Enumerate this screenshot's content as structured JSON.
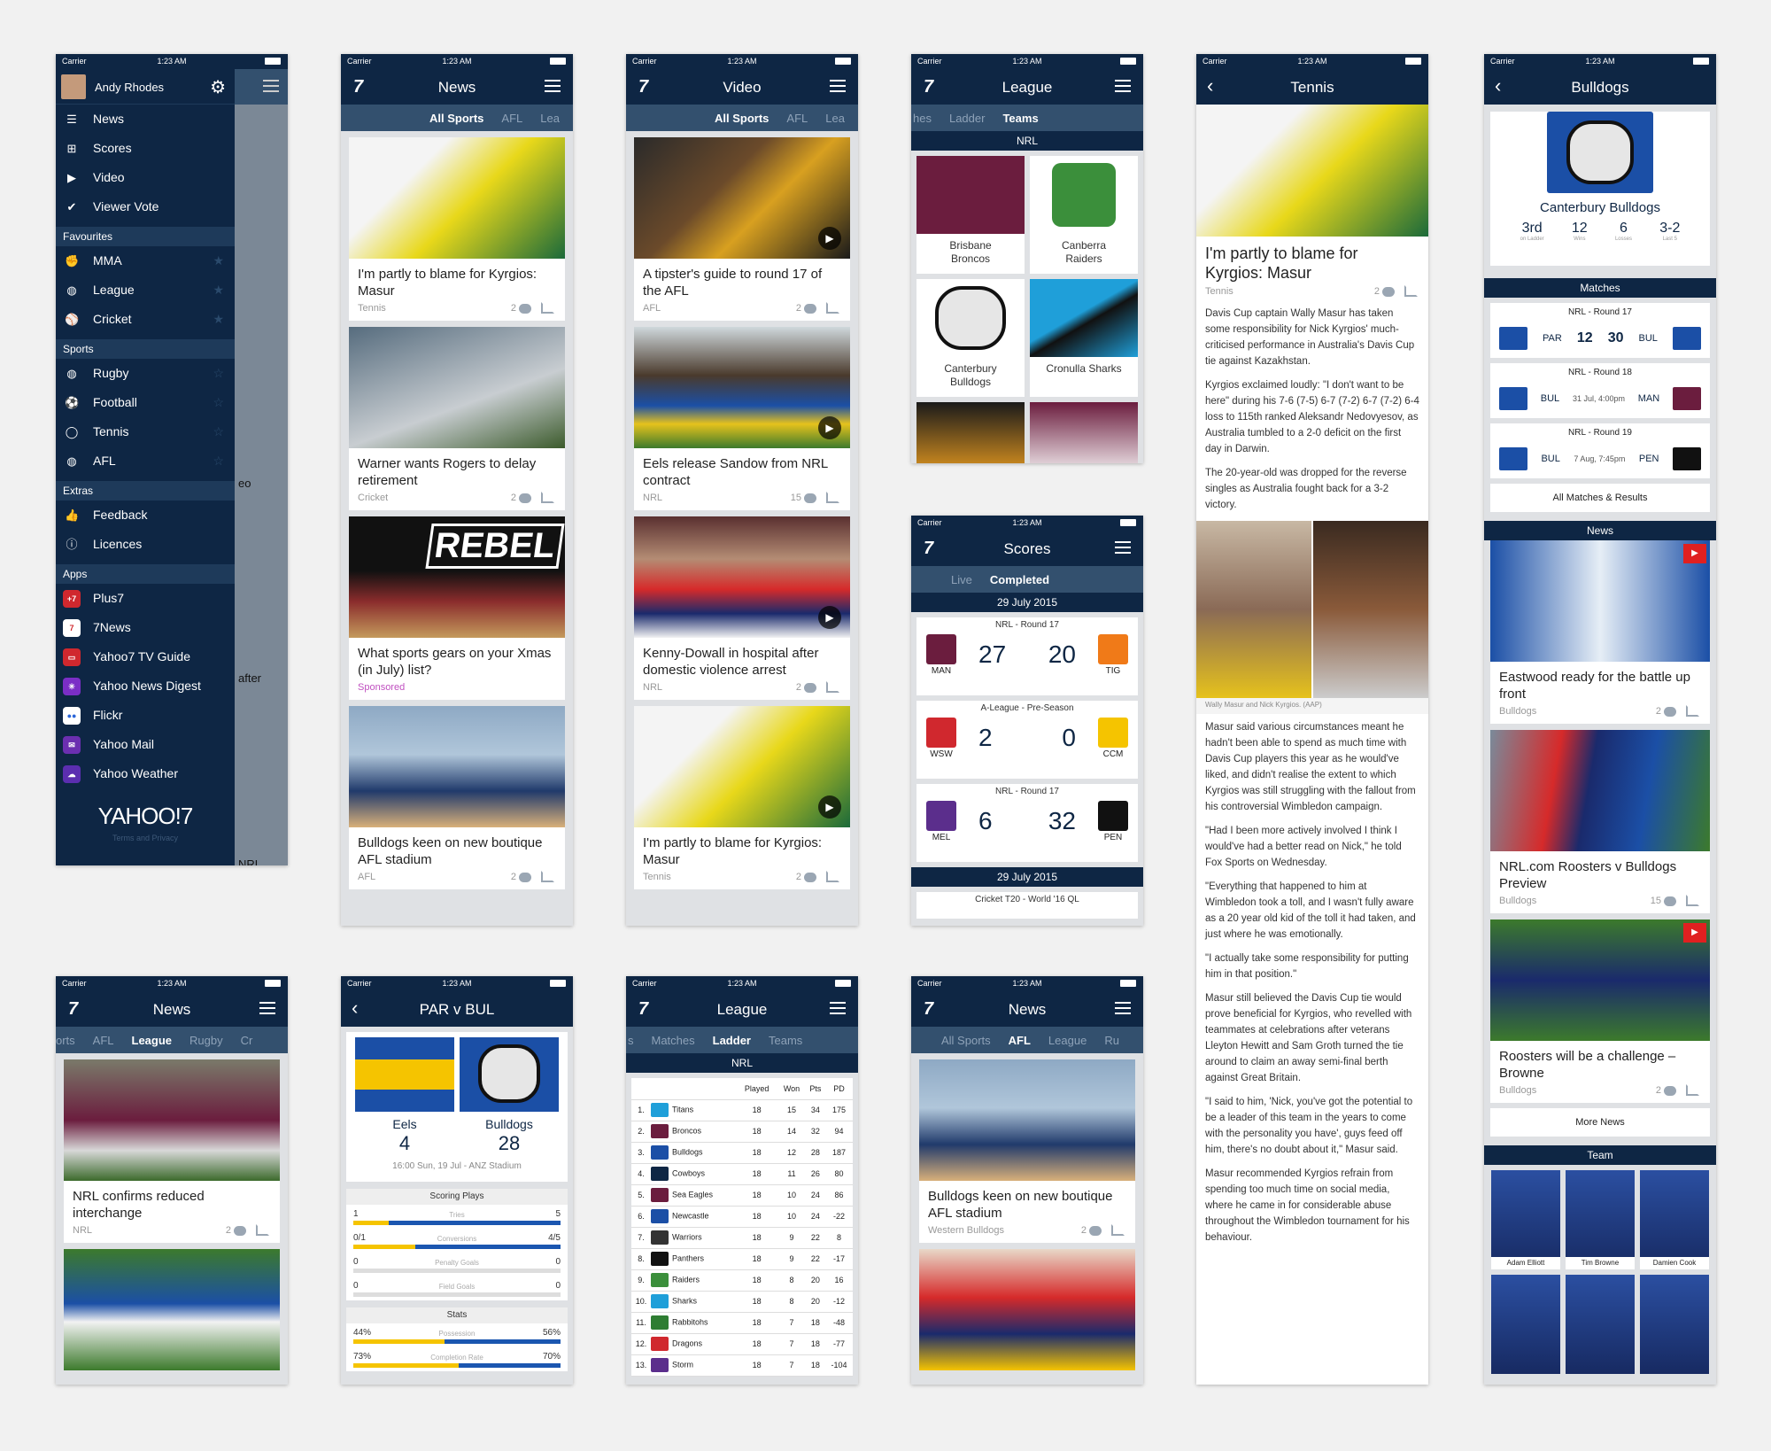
{
  "status": {
    "carrier": "Carrier",
    "time": "1:23 AM"
  },
  "drawer": {
    "user": "Andy Rhodes",
    "main": [
      {
        "label": "News",
        "icon": "news-icon"
      },
      {
        "label": "Scores",
        "icon": "scores-icon"
      },
      {
        "label": "Video",
        "icon": "video-icon"
      },
      {
        "label": "Viewer Vote",
        "icon": "check-icon"
      }
    ],
    "fav_title": "Favourites",
    "favs": [
      {
        "label": "MMA"
      },
      {
        "label": "League"
      },
      {
        "label": "Cricket"
      }
    ],
    "sports_title": "Sports",
    "sports": [
      {
        "label": "Rugby"
      },
      {
        "label": "Football"
      },
      {
        "label": "Tennis"
      },
      {
        "label": "AFL"
      }
    ],
    "extras_title": "Extras",
    "extras": [
      {
        "label": "Feedback"
      },
      {
        "label": "Licences"
      }
    ],
    "apps_title": "Apps",
    "apps": [
      {
        "label": "Plus7",
        "color": "#d0282e"
      },
      {
        "label": "7News",
        "color": "#d0282e"
      },
      {
        "label": "Yahoo7 TV Guide",
        "color": "#d0282e"
      },
      {
        "label": "Yahoo News Digest",
        "color": "#7b2ec6"
      },
      {
        "label": "Flickr",
        "color": "#2b66d9"
      },
      {
        "label": "Yahoo Mail",
        "color": "#6b2fb0"
      },
      {
        "label": "Yahoo Weather",
        "color": "#5b2eb0"
      }
    ],
    "brand": "YAHOO!7",
    "terms": "Terms and Privacy",
    "behind": [
      "eo",
      "after",
      "NRL"
    ]
  },
  "news": {
    "title": "News",
    "tabs": [
      "All Sports",
      "AFL",
      "Lea"
    ],
    "cards": [
      {
        "title": "I'm partly to blame for Kyrgios: Masur",
        "tag": "Tennis",
        "count": "2"
      },
      {
        "title": "Warner wants Rogers to delay retirement",
        "tag": "Cricket",
        "count": "2"
      },
      {
        "title": "What sports gears on your Xmas (in July) list?",
        "tag": "Sponsored",
        "count": ""
      },
      {
        "title": "Bulldogs keen on new boutique AFL stadium",
        "tag": "AFL",
        "count": "2"
      }
    ],
    "rebel": "REBEL"
  },
  "video": {
    "title": "Video",
    "tabs": [
      "All Sports",
      "AFL",
      "Lea"
    ],
    "cards": [
      {
        "title": "A tipster's guide to round 17 of the AFL",
        "tag": "AFL",
        "count": "2"
      },
      {
        "title": "Eels release Sandow from NRL contract",
        "tag": "NRL",
        "count": "15"
      },
      {
        "title": "Kenny-Dowall in hospital after domestic violence arrest",
        "tag": "NRL",
        "count": "2"
      },
      {
        "title": "I'm partly to blame for Kyrgios: Masur",
        "tag": "Tennis",
        "count": "2"
      }
    ]
  },
  "league": {
    "title": "League",
    "tabs": [
      "hes",
      "Ladder",
      "Teams"
    ],
    "comp": "NRL",
    "teams": [
      {
        "name": "Brisbane Broncos",
        "color": "#6b1d3e"
      },
      {
        "name": "Canberra Raiders",
        "color": "#3b8f3b"
      },
      {
        "name": "Canterbury Bulldogs",
        "color": "#1b4fa6"
      },
      {
        "name": "Cronulla Sharks",
        "color": "#1f9fd9"
      },
      {
        "name": "",
        "color": "#1a1a1a"
      },
      {
        "name": "",
        "color": "#6b1d3e"
      }
    ]
  },
  "scores": {
    "title": "Scores",
    "tabs": [
      "Live",
      "Completed"
    ],
    "date": "29 July 2015",
    "games": [
      {
        "round": "NRL - Round 17",
        "home": "MAN",
        "hs": "27",
        "away": "TIG",
        "as": "20",
        "hc": "#6b1d3e",
        "ac": "#f07a18"
      },
      {
        "round": "A-League - Pre-Season",
        "home": "WSW",
        "hs": "2",
        "away": "CCM",
        "as": "0",
        "hc": "#d0282e",
        "ac": "#f5c400"
      },
      {
        "round": "NRL - Round 17",
        "home": "MEL",
        "hs": "6",
        "away": "PEN",
        "as": "32",
        "hc": "#5b2e8c",
        "ac": "#111"
      }
    ],
    "date2": "29 July 2015",
    "next": "Cricket T20 - World '16 QL"
  },
  "tennis": {
    "title": "Tennis",
    "headline": "I'm partly to blame for Kyrgios: Masur",
    "tag": "Tennis",
    "count": "2",
    "paras": [
      "Davis Cup captain Wally Masur has taken some responsibility for Nick Kyrgios' much-criticised performance in Australia's Davis Cup tie against Kazakhstan.",
      "Kyrgios exclaimed loudly: \"I don't want to be here\" during his 7-6 (7-5) 6-7 (7-2) 6-7 (7-2) 6-4 loss to 115th ranked Aleksandr Nedovyesov, as Australia tumbled to a 2-0 deficit on the first day in Darwin.",
      "The 20-year-old was dropped for the reverse singles as Australia fought back for a 3-2 victory."
    ],
    "caption": "Wally Masur and Nick Kyrgios. (AAP)",
    "paras2": [
      "Masur said various circumstances meant he hadn't been able to spend as much time with Davis Cup players this year as he would've liked, and didn't realise the extent to which Kyrgios was still struggling with the fallout from his controversial Wimbledon campaign.",
      "\"Had I been more actively involved I think I would've had a better read on Nick,\" he told Fox Sports on Wednesday.",
      "\"Everything that happened to him at Wimbledon took a toll, and I wasn't fully aware as a 20 year old kid of the toll it had taken, and just where he was emotionally.",
      "\"I actually take some responsibility for putting him in that position.\"",
      "Masur still believed the Davis Cup tie would prove beneficial for Kyrgios, who revelled with teammates at celebrations after veterans Lleyton Hewitt and Sam Groth turned the tie around to claim an away semi-final berth against Great Britain.",
      "\"I said to him, 'Nick, you've got the potential to be a leader of this team in the years to come with the personality you have', guys feed off him, there's no doubt about it,\" Masur said.",
      "Masur recommended Kyrgios refrain from spending too much time on social media, where he came in for considerable abuse throughout the Wimbledon tournament for his behaviour."
    ]
  },
  "bulldogs": {
    "title": "Bulldogs",
    "team": "Canterbury Bulldogs",
    "stats": [
      {
        "v": "3rd",
        "l": "on Ladder"
      },
      {
        "v": "12",
        "l": "Wins"
      },
      {
        "v": "6",
        "l": "Losses"
      },
      {
        "v": "3-2",
        "l": "Last 5"
      }
    ],
    "matches_title": "Matches",
    "matches": [
      {
        "round": "NRL - Round 17",
        "l": "PAR",
        "mid": "12",
        "mid2": "30",
        "r": "BUL",
        "lc": "#1b4fa6",
        "rc": "#1b4fa6"
      },
      {
        "round": "NRL - Round 18",
        "l": "BUL",
        "mid": "31 Jul, 4:00pm",
        "mid2": "",
        "r": "MAN",
        "lc": "#1b4fa6",
        "rc": "#6b1d3e"
      },
      {
        "round": "NRL - Round 19",
        "l": "BUL",
        "mid": "7 Aug, 7:45pm",
        "mid2": "",
        "r": "PEN",
        "lc": "#1b4fa6",
        "rc": "#111"
      }
    ],
    "all_matches": "All Matches & Results",
    "news_title": "News",
    "news": [
      {
        "title": "Eastwood ready for the battle up front",
        "tag": "Bulldogs",
        "count": "2"
      },
      {
        "title": "NRL.com Roosters v Bulldogs Preview",
        "tag": "Bulldogs",
        "count": "15"
      },
      {
        "title": "Roosters will be a challenge – Browne",
        "tag": "Bulldogs",
        "count": "2"
      }
    ],
    "more_news": "More News",
    "team_title": "Team",
    "players": [
      "Adam Elliott",
      "Tim Browne",
      "Damien Cook",
      "",
      "",
      ""
    ]
  },
  "news2": {
    "title": "News",
    "tabs": [
      "orts",
      "AFL",
      "League",
      "Rugby",
      "Cr"
    ],
    "cards": [
      {
        "title": "NRL confirms reduced interchange",
        "tag": "NRL",
        "count": "2"
      }
    ]
  },
  "match": {
    "title": "PAR v BUL",
    "home": "Eels",
    "hs": "4",
    "away": "Bulldogs",
    "as": "28",
    "info": "16:00 Sun, 19 Jul - ANZ Stadium",
    "scoring_title": "Scoring Plays",
    "scoring": [
      {
        "l": "1",
        "label": "Tries",
        "r": "5",
        "p": 0.17
      },
      {
        "l": "0/1",
        "label": "Conversions",
        "r": "4/5",
        "p": 0.3
      },
      {
        "l": "0",
        "label": "Penalty Goals",
        "r": "0",
        "p": 0.5
      },
      {
        "l": "0",
        "label": "Field Goals",
        "r": "0",
        "p": 0.5
      }
    ],
    "stats_title": "Stats",
    "stats": [
      {
        "l": "44%",
        "label": "Possession",
        "r": "56%",
        "p": 0.44
      },
      {
        "l": "73%",
        "label": "Completion Rate",
        "r": "70%",
        "p": 0.51
      }
    ]
  },
  "ladder": {
    "title": "League",
    "tabs": [
      "s",
      "Matches",
      "Ladder",
      "Teams"
    ],
    "comp": "NRL",
    "cols": [
      "",
      "",
      "Played",
      "Won",
      "Pts",
      "PD"
    ],
    "rows": [
      [
        "1.",
        "Titans",
        "18",
        "15",
        "34",
        "175",
        "#1f9fd9"
      ],
      [
        "2.",
        "Broncos",
        "18",
        "14",
        "32",
        "94",
        "#6b1d3e"
      ],
      [
        "3.",
        "Bulldogs",
        "18",
        "12",
        "28",
        "187",
        "#1b4fa6"
      ],
      [
        "4.",
        "Cowboys",
        "18",
        "11",
        "26",
        "80",
        "#0e2644"
      ],
      [
        "5.",
        "Sea Eagles",
        "18",
        "10",
        "24",
        "86",
        "#6b1d3e"
      ],
      [
        "6.",
        "Newcastle",
        "18",
        "10",
        "24",
        "-22",
        "#1b4fa6"
      ],
      [
        "7.",
        "Warriors",
        "18",
        "9",
        "22",
        "8",
        "#333"
      ],
      [
        "8.",
        "Panthers",
        "18",
        "9",
        "22",
        "-17",
        "#111"
      ],
      [
        "9.",
        "Raiders",
        "18",
        "8",
        "20",
        "16",
        "#3b8f3b"
      ],
      [
        "10.",
        "Sharks",
        "18",
        "8",
        "20",
        "-12",
        "#1f9fd9"
      ],
      [
        "11.",
        "Rabbitohs",
        "18",
        "7",
        "18",
        "-48",
        "#2e7d32"
      ],
      [
        "12.",
        "Dragons",
        "18",
        "7",
        "18",
        "-77",
        "#d0282e"
      ],
      [
        "13.",
        "Storm",
        "18",
        "7",
        "18",
        "-104",
        "#5b2e8c"
      ]
    ]
  },
  "news3": {
    "title": "News",
    "tabs": [
      "All Sports",
      "AFL",
      "League",
      "Ru"
    ],
    "cards": [
      {
        "title": "Bulldogs keen on new boutique AFL stadium",
        "tag": "Western Bulldogs",
        "count": "2"
      }
    ]
  }
}
